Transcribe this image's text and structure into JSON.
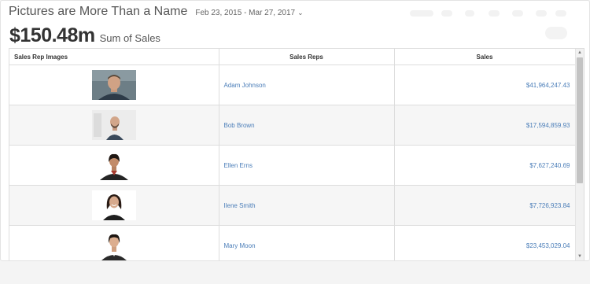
{
  "header": {
    "title": "Pictures are More Than a Name",
    "date_range": "Feb 23, 2015 - Mar 27, 2017"
  },
  "kpi": {
    "value": "$150.48m",
    "label": "Sum of Sales"
  },
  "table": {
    "columns": [
      "Sales Rep Images",
      "Sales Reps",
      "Sales"
    ],
    "rows": [
      {
        "name": "Adam Johnson",
        "sales": "$41,964,247.43",
        "photo": "photo-adam-johnson"
      },
      {
        "name": "Bob Brown",
        "sales": "$17,594,859.93",
        "photo": "photo-bob-brown"
      },
      {
        "name": "Ellen Erns",
        "sales": "$7,627,240.69",
        "photo": "photo-ellen-erns"
      },
      {
        "name": "Ilene Smith",
        "sales": "$7,726,923.84",
        "photo": "photo-ilene-smith"
      },
      {
        "name": "Mary Moon",
        "sales": "$23,453,029.04",
        "photo": "photo-mary-moon"
      }
    ]
  },
  "icons": {
    "date_dropdown": "chevron-down-icon",
    "scroll_up": "scroll-up-arrow-icon",
    "scroll_down": "scroll-down-arrow-icon"
  }
}
